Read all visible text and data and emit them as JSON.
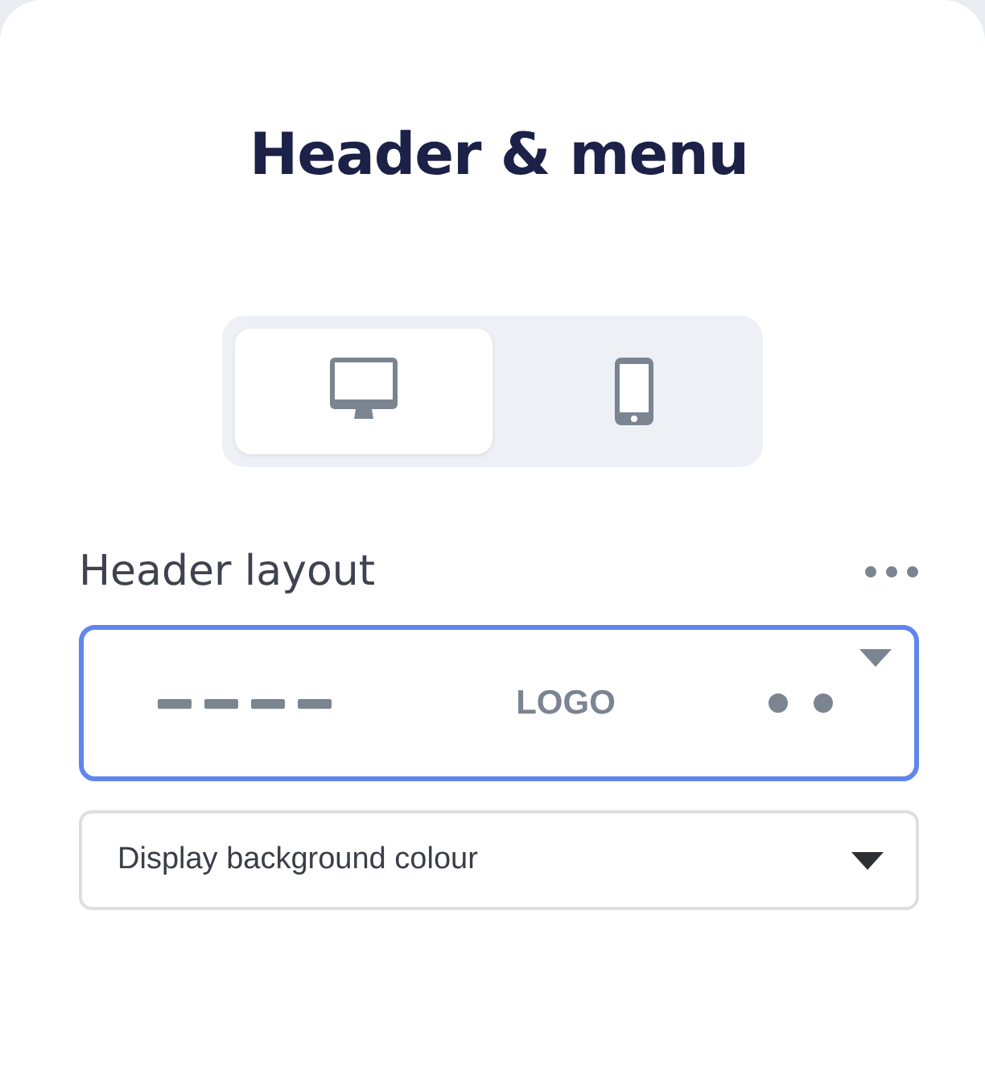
{
  "title": "Header & menu",
  "device_tabs": [
    {
      "kind": "desktop",
      "selected": true
    },
    {
      "kind": "mobile",
      "selected": false
    }
  ],
  "header_layout": {
    "label": "Header layout",
    "preview_logo": "LOGO",
    "focused": true
  },
  "background_select": {
    "value": "Display background colour"
  }
}
